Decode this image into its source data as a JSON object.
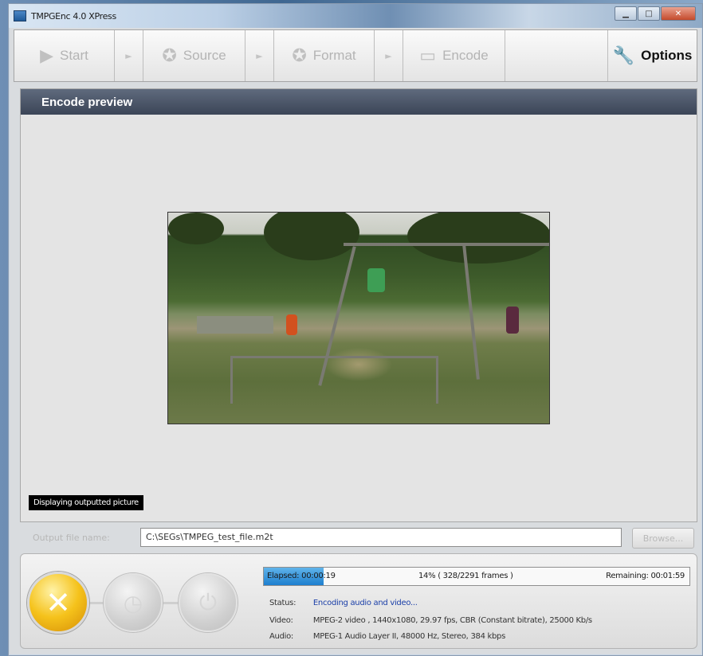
{
  "window": {
    "title": "TMPGEnc 4.0 XPress",
    "controls": [
      "minimize",
      "maximize",
      "close"
    ]
  },
  "toolbar": {
    "items": [
      {
        "label": "Start",
        "icon": "play-arrow-icon"
      },
      {
        "label": "Source",
        "icon": "film-reel-icon"
      },
      {
        "label": "Format",
        "icon": "film-reel-icon"
      },
      {
        "label": "Encode",
        "icon": "film-strip-icon"
      }
    ],
    "separator_glyph": "►",
    "options_label": "Options",
    "options_icon": "wrench-icon"
  },
  "preview": {
    "header": "Encode preview",
    "overlay_text": "Displaying outputted picture"
  },
  "output": {
    "label": "Output file name:",
    "filename": "C:\\SEGs\\TMPEG_test_file.m2t",
    "browse_label": "Browse..."
  },
  "encode": {
    "progress_fraction": 0.14,
    "elapsed": "Elapsed: 00:00:19",
    "progress_text": "14% ( 328/2291  frames )",
    "remaining": "Remaining: 00:01:59",
    "status_key": "Status:",
    "status_value": "Encoding audio and video...",
    "video_key": "Video:",
    "video_value": "MPEG-2 video , 1440x1080, 29.97 fps, CBR (Constant bitrate), 25000 Kb/s",
    "audio_key": "Audio:",
    "audio_value": "MPEG-1 Audio Layer II, 48000 Hz, Stereo, 384 kbps",
    "colors": {
      "progress": "#1e7fcf",
      "cancel": "#f5c21b",
      "status_text": "#1b3fa8"
    }
  }
}
